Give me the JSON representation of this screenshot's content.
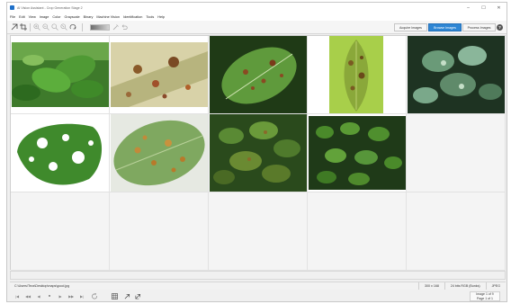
{
  "window": {
    "title": "AI Vision Assistant - Crop Generation Stage 2",
    "controls": [
      "–",
      "☐",
      "✕"
    ]
  },
  "menu": [
    "File",
    "Edit",
    "View",
    "Image",
    "Color",
    "Grayscale",
    "Binary",
    "Machine Vision",
    "Identification",
    "Tools",
    "Help"
  ],
  "toolbar": {
    "icons": [
      "select-icon",
      "crop-icon",
      "zoom-in-icon",
      "zoom-out-icon",
      "zoom-fit-icon",
      "zoom-actual-icon",
      "rotate-icon",
      "gradient-swatch",
      "color-picker-icon",
      "undo-icon"
    ],
    "tabs": [
      {
        "label": "Acquire Images",
        "active": false
      },
      {
        "label": "Browse Images",
        "active": true
      },
      {
        "label": "Process Images",
        "active": false
      }
    ],
    "help_label": "?",
    "accent": "#2e86d4"
  },
  "thumbnails": [
    {
      "subject": "green-leaves-icon"
    },
    {
      "subject": "spotted-leaf-icon"
    },
    {
      "subject": "rust-leaf-icon"
    },
    {
      "subject": "diseased-leaf-icon"
    },
    {
      "subject": "mottled-leaves-icon"
    },
    {
      "subject": "eaten-leaf-icon"
    },
    {
      "subject": "rusty-leaf-closeup-icon"
    },
    {
      "subject": "tomato-leaves-icon"
    },
    {
      "subject": "seedlings-icon"
    }
  ],
  "grid": {
    "columns": 5,
    "rows": 3
  },
  "status": {
    "path": "C:\\Users\\Tecs\\Desktop\\maps\\good.jpg",
    "dimensions": "300 x 168",
    "color_depth": "24 bits RGB (Bunks)",
    "format": "JPEG"
  },
  "navigator": {
    "buttons": [
      "|◀",
      "◀◀",
      "◀",
      "■",
      "▶",
      "▶▶",
      "▶|"
    ],
    "image_text": "Image 1 of 9",
    "page_text": "Page 1 of 1"
  }
}
